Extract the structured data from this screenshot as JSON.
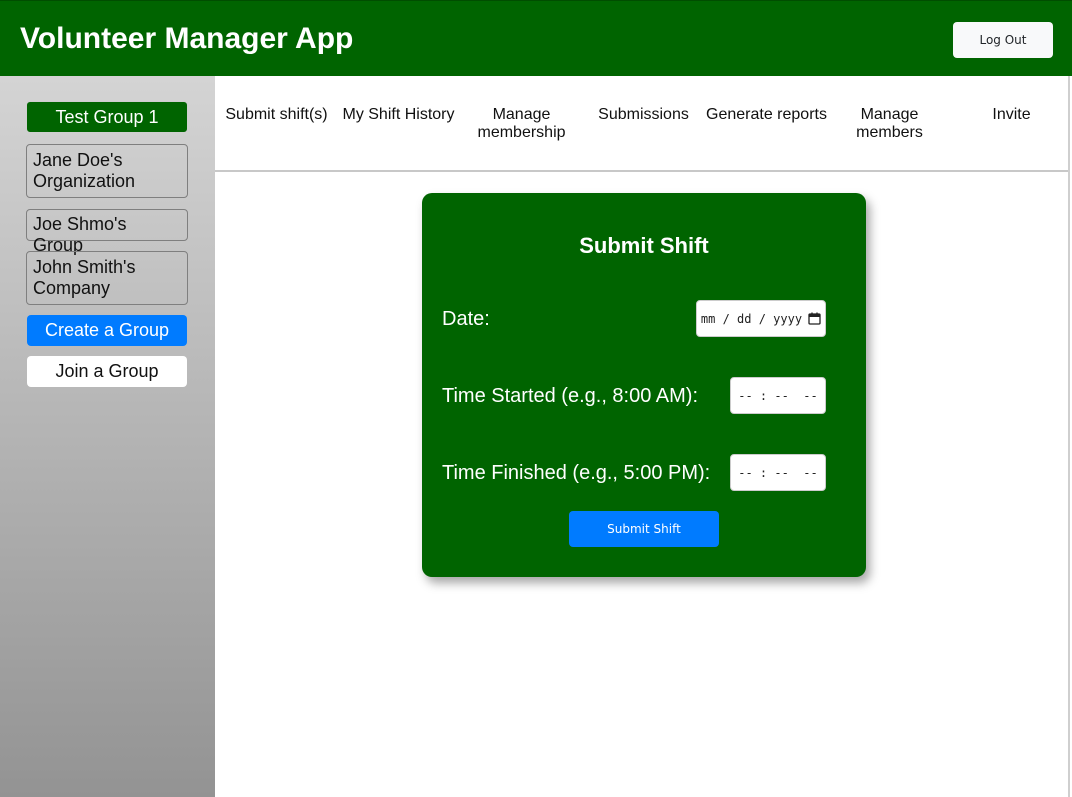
{
  "header": {
    "title": "Volunteer Manager App",
    "logout_label": "Log Out"
  },
  "sidebar": {
    "groups": [
      {
        "label": "Test Group 1",
        "active": true
      },
      {
        "label": "Jane Doe's Organization",
        "active": false
      },
      {
        "label": "Joe Shmo's Group",
        "active": false
      },
      {
        "label": "John Smith's Company",
        "active": false
      }
    ],
    "create_label": "Create a Group",
    "join_label": "Join a Group"
  },
  "nav": {
    "items": [
      {
        "label": "Submit shift(s)"
      },
      {
        "label": "My Shift History"
      },
      {
        "label": "Manage membership"
      },
      {
        "label": "Submissions"
      },
      {
        "label": "Generate reports"
      },
      {
        "label": "Manage members"
      },
      {
        "label": "Invite"
      }
    ]
  },
  "form": {
    "title": "Submit Shift",
    "date_label": "Date:",
    "date_placeholder": "mm / dd / yyyy",
    "time_started_label": "Time Started (e.g., 8:00 AM):",
    "time_started_placeholder": "-- : --  --",
    "time_finished_label": "Time Finished (e.g., 5:00 PM):",
    "time_finished_placeholder": "-- : --  --",
    "submit_label": "Submit Shift"
  },
  "colors": {
    "brand_green": "#006400",
    "accent_blue": "#007bff"
  }
}
